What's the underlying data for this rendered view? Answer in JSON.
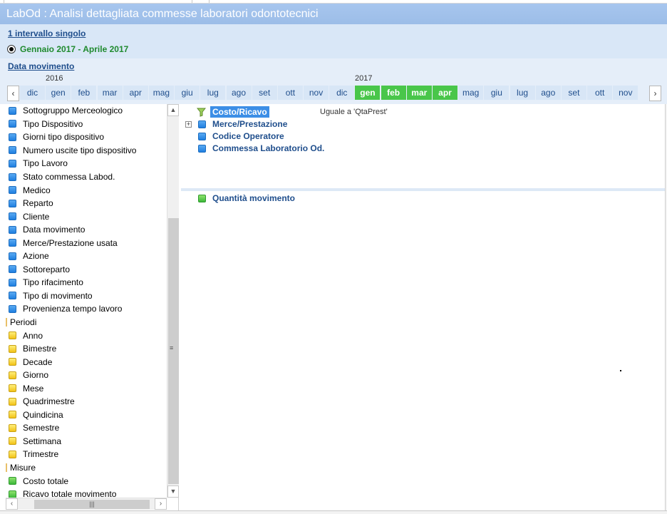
{
  "window": {
    "app": "LabOd",
    "title": " : Analisi dettagliata commesse laboratori odontotecnici"
  },
  "header": {
    "interval_link": "1 intervallo singolo",
    "period_label": "Gennaio 2017 - Aprile 2017"
  },
  "timeline": {
    "link": "Data movimento",
    "years": [
      "2016",
      "2017"
    ],
    "months": [
      {
        "label": "dic",
        "selected": false
      },
      {
        "label": "gen",
        "selected": false
      },
      {
        "label": "feb",
        "selected": false
      },
      {
        "label": "mar",
        "selected": false
      },
      {
        "label": "apr",
        "selected": false
      },
      {
        "label": "mag",
        "selected": false
      },
      {
        "label": "giu",
        "selected": false
      },
      {
        "label": "lug",
        "selected": false
      },
      {
        "label": "ago",
        "selected": false
      },
      {
        "label": "set",
        "selected": false
      },
      {
        "label": "ott",
        "selected": false
      },
      {
        "label": "nov",
        "selected": false
      },
      {
        "label": "dic",
        "selected": false
      },
      {
        "label": "gen",
        "selected": true
      },
      {
        "label": "feb",
        "selected": true
      },
      {
        "label": "mar",
        "selected": true
      },
      {
        "label": "apr",
        "selected": true
      },
      {
        "label": "mag",
        "selected": false
      },
      {
        "label": "giu",
        "selected": false
      },
      {
        "label": "lug",
        "selected": false
      },
      {
        "label": "ago",
        "selected": false
      },
      {
        "label": "set",
        "selected": false
      },
      {
        "label": "ott",
        "selected": false
      },
      {
        "label": "nov",
        "selected": false
      }
    ],
    "prev_icon": "chevron-left-icon",
    "next_icon": "chevron-right-icon"
  },
  "field_list": [
    {
      "kind": "item",
      "color": "blue",
      "label": "Sottogruppo Merceologico"
    },
    {
      "kind": "item",
      "color": "blue",
      "label": "Tipo Dispositivo"
    },
    {
      "kind": "item",
      "color": "blue",
      "label": "Giorni tipo dispositivo"
    },
    {
      "kind": "item",
      "color": "blue",
      "label": "Numero uscite tipo dispositivo"
    },
    {
      "kind": "item",
      "color": "blue",
      "label": "Tipo Lavoro"
    },
    {
      "kind": "item",
      "color": "blue",
      "label": "Stato commessa Labod."
    },
    {
      "kind": "item",
      "color": "blue",
      "label": "Medico"
    },
    {
      "kind": "item",
      "color": "blue",
      "label": "Reparto"
    },
    {
      "kind": "item",
      "color": "blue",
      "label": "Cliente"
    },
    {
      "kind": "item",
      "color": "blue",
      "label": "Data movimento"
    },
    {
      "kind": "item",
      "color": "blue",
      "label": "Merce/Prestazione usata"
    },
    {
      "kind": "item",
      "color": "blue",
      "label": "Azione"
    },
    {
      "kind": "item",
      "color": "blue",
      "label": "Sottoreparto"
    },
    {
      "kind": "item",
      "color": "blue",
      "label": "Tipo rifacimento"
    },
    {
      "kind": "item",
      "color": "blue",
      "label": "Tipo di movimento"
    },
    {
      "kind": "item",
      "color": "blue",
      "label": "Provenienza tempo lavoro"
    },
    {
      "kind": "group",
      "label": "Periodi"
    },
    {
      "kind": "item",
      "color": "yellow",
      "label": "Anno"
    },
    {
      "kind": "item",
      "color": "yellow",
      "label": "Bimestre"
    },
    {
      "kind": "item",
      "color": "yellow",
      "label": "Decade"
    },
    {
      "kind": "item",
      "color": "yellow",
      "label": "Giorno"
    },
    {
      "kind": "item",
      "color": "yellow",
      "label": "Mese"
    },
    {
      "kind": "item",
      "color": "yellow",
      "label": "Quadrimestre"
    },
    {
      "kind": "item",
      "color": "yellow",
      "label": "Quindicina"
    },
    {
      "kind": "item",
      "color": "yellow",
      "label": "Semestre"
    },
    {
      "kind": "item",
      "color": "yellow",
      "label": "Settimana"
    },
    {
      "kind": "item",
      "color": "yellow",
      "label": "Trimestre"
    },
    {
      "kind": "group",
      "label": "Misure"
    },
    {
      "kind": "item",
      "color": "green",
      "label": "Costo totale"
    },
    {
      "kind": "item",
      "color": "green",
      "label": "Ricavo totale movimento"
    }
  ],
  "scrollbars": {
    "up_icon": "chevron-up-icon",
    "down_icon": "chevron-down-icon",
    "left_icon": "chevron-left-icon",
    "right_icon": "chevron-right-icon"
  },
  "dimensions_panel": {
    "filtered_item": "Costo/Ricavo",
    "filter_condition": "Uguale a 'QtaPrest'",
    "items": [
      "Merce/Prestazione",
      "Codice Operatore",
      "Commessa Laboratorio Od."
    ]
  },
  "measures_panel": {
    "items": [
      "Quantità movimento"
    ]
  },
  "colors": {
    "title_bar": "#9cbde8",
    "selected_month": "#49c64a",
    "dimension_blue": "#1f7fe0",
    "period_yellow": "#f2c318",
    "measure_green": "#3cb83a",
    "link_text": "#1f4e8c"
  }
}
